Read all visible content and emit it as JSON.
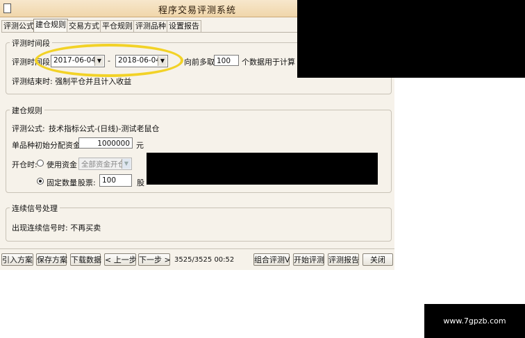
{
  "window": {
    "title": "程序交易评测系统"
  },
  "tabs": [
    "评测公式",
    "建仓规则",
    "交易方式",
    "平仓规则",
    "评测品种",
    "设置报告"
  ],
  "period": {
    "group_title": "评测时间段",
    "label": "评测时间段:",
    "start_date": "2017-06-04",
    "separator": "-",
    "end_date": "2018-06-04",
    "lookback_prefix": "向前多取",
    "lookback_value": "100",
    "lookback_suffix": "个数据用于计算",
    "end_note": "评测结束时: 强制平仓并且计入收益"
  },
  "build_rules": {
    "group_title": "建仓规则",
    "formula_label": "评测公式:",
    "formula_value": "技术指标公式-(日线)-测试老鼠仓",
    "capital_label": "单品种初始分配资金:",
    "capital_value": "1000000",
    "capital_unit": "元",
    "open_label": "开仓时:",
    "use_capital_label": "使用资金",
    "use_capital_option": "全部资金开仓",
    "fixed_qty_label": "固定数量",
    "shares_label": "股票:",
    "shares_value": "100",
    "shares_unit": "股",
    "selected_mode": "fixed_quantity"
  },
  "signal": {
    "group_title": "连续信号处理",
    "text": "出现连续信号时: 不再买卖"
  },
  "toolbar": {
    "import": "引入方案",
    "save": "保存方案",
    "download": "下载数据",
    "prev": "< 上一步",
    "next": "下一步 >",
    "status": "3525/3525 00:52",
    "combo_eval": "组合评测V",
    "start_eval": "开始评测",
    "report": "评测报告",
    "close": "关闭"
  },
  "watermark": "www.7gpzb.com",
  "colors": {
    "title_bar": "#f0d6aa",
    "highlight_ellipse": "#f2d227"
  }
}
